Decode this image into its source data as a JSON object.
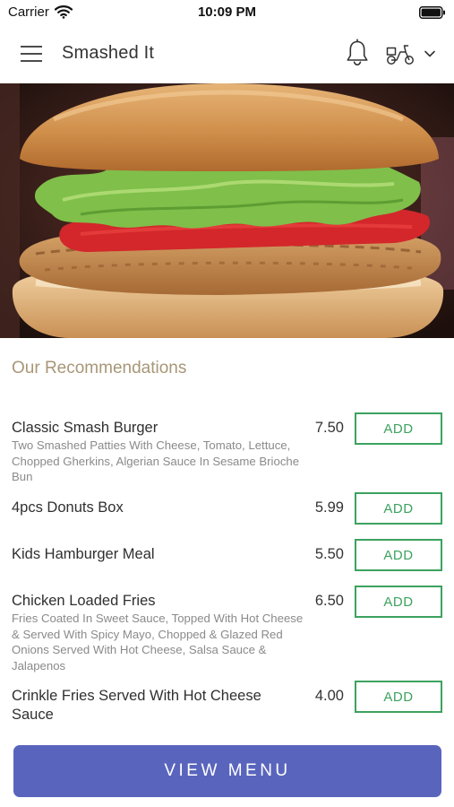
{
  "status_bar": {
    "carrier": "Carrier",
    "time": "10:09 PM",
    "wifi_icon": "wifi-icon",
    "battery_icon": "battery-icon"
  },
  "header": {
    "title": "Smashed It",
    "menu_icon": "hamburger-menu-icon",
    "notification_icon": "bell-icon",
    "delivery_mode_icon": "scooter-icon",
    "dropdown_icon": "chevron-down-icon"
  },
  "hero": {
    "image": "burger-photo"
  },
  "recommendations": {
    "title": "Our Recommendations",
    "add_label": "ADD",
    "items": [
      {
        "name": "Classic Smash Burger",
        "description": "Two Smashed Patties With Cheese, Tomato, Lettuce, Chopped Gherkins, Algerian Sauce In Sesame Brioche Bun",
        "price": "7.50"
      },
      {
        "name": "4pcs Donuts Box",
        "description": "",
        "price": "5.99"
      },
      {
        "name": "Kids Hamburger Meal",
        "description": "",
        "price": "5.50"
      },
      {
        "name": "Chicken Loaded Fries",
        "description": "Fries Coated In Sweet Sauce, Topped With Hot Cheese & Served With Spicy Mayo, Chopped & Glazed Red Onions Served With Hot Cheese, Salsa Sauce & Jalapenos",
        "price": "6.50"
      },
      {
        "name": "Crinkle Fries Served With Hot Cheese Sauce",
        "description": "",
        "price": "4.00"
      }
    ]
  },
  "footer": {
    "view_menu_label": "VIEW MENU"
  },
  "colors": {
    "accent": "#5965bd",
    "add_green": "#3ca25e",
    "section_title": "#a89677"
  }
}
